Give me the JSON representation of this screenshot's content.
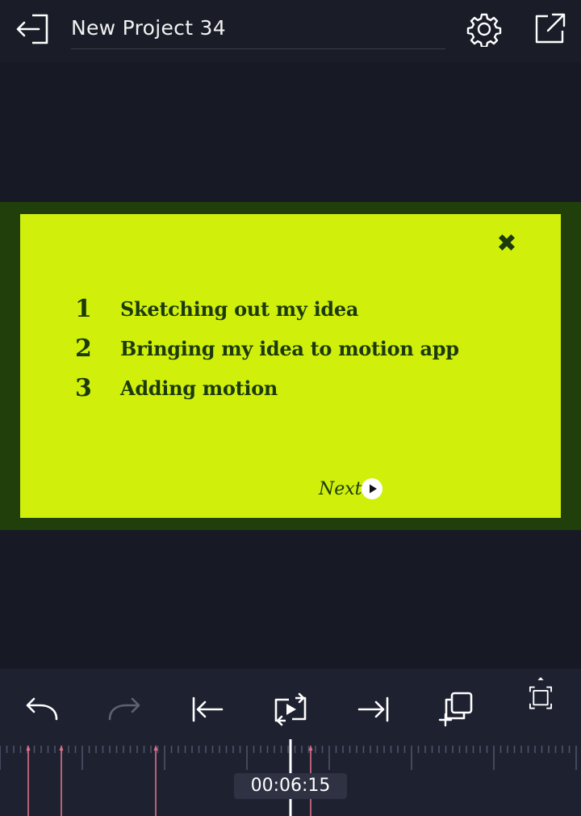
{
  "header": {
    "title": "New Project 34",
    "back_icon": "exit-icon",
    "settings_icon": "gear-icon",
    "export_icon": "share-out-icon"
  },
  "slide": {
    "background_color": "#d0f00c",
    "border_color": "#203f0b",
    "text_color": "#1c3a0b",
    "close_symbol": "✖",
    "steps": [
      {
        "number": "1",
        "text": "Sketching out my idea"
      },
      {
        "number": "2",
        "text": "Bringing my idea to motion app"
      },
      {
        "number": "3",
        "text": "Adding motion"
      }
    ],
    "next_label": "Next"
  },
  "toolbar": {
    "items": [
      "undo-icon",
      "redo-icon",
      "jump-to-start-icon",
      "play-loop-icon",
      "jump-to-end-icon",
      "add-copy-icon",
      "fit-screen-icon"
    ],
    "redo_enabled": false
  },
  "timeline": {
    "timecode": "00:06:15",
    "marker_color": "#e0708a"
  }
}
